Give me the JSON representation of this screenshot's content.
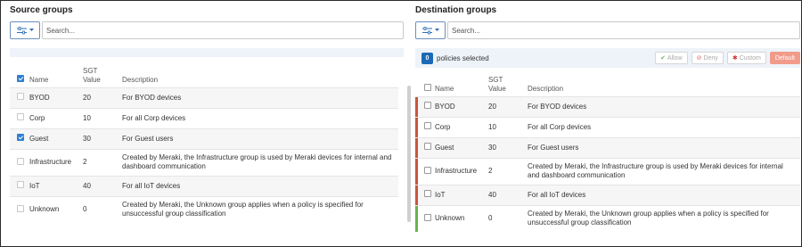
{
  "source": {
    "title": "Source groups",
    "search_placeholder": "Search...",
    "columns": {
      "name": "Name",
      "sgt": "SGT\nValue",
      "description": "Description"
    },
    "rows": [
      {
        "name": "BYOD",
        "sgt": "20",
        "description": "For BYOD devices",
        "checked": false
      },
      {
        "name": "Corp",
        "sgt": "10",
        "description": "For all Corp devices",
        "checked": false
      },
      {
        "name": "Guest",
        "sgt": "30",
        "description": "For Guest users",
        "checked": true
      },
      {
        "name": "Infrastructure",
        "sgt": "2",
        "description": "Created by Meraki, the Infrastructure group is used by Meraki devices for internal and dashboard communication",
        "checked": false
      },
      {
        "name": "IoT",
        "sgt": "40",
        "description": "For all IoT devices",
        "checked": false
      },
      {
        "name": "Unknown",
        "sgt": "0",
        "description": "Created by Meraki, the Unknown group applies when a policy is specified for unsuccessful group classification",
        "checked": false
      }
    ]
  },
  "destination": {
    "title": "Destination groups",
    "search_placeholder": "Search...",
    "selected_count": "0",
    "selected_text": "policies selected",
    "actions": {
      "allow": "Allow",
      "deny": "Deny",
      "custom": "Custom",
      "default": "Default"
    },
    "columns": {
      "name": "Name",
      "sgt": "SGT\nValue",
      "description": "Description"
    },
    "rows": [
      {
        "name": "BYOD",
        "sgt": "20",
        "description": "For BYOD devices",
        "bar": "#c8553d"
      },
      {
        "name": "Corp",
        "sgt": "10",
        "description": "For all Corp devices",
        "bar": "#c8553d"
      },
      {
        "name": "Guest",
        "sgt": "30",
        "description": "For Guest users",
        "bar": "#c8553d"
      },
      {
        "name": "Infrastructure",
        "sgt": "2",
        "description": "Created by Meraki, the Infrastructure group is used by Meraki devices for internal and dashboard communication",
        "bar": "#c8553d"
      },
      {
        "name": "IoT",
        "sgt": "40",
        "description": "For all IoT devices",
        "bar": "#c8553d"
      },
      {
        "name": "Unknown",
        "sgt": "0",
        "description": "Created by Meraki, the Unknown group applies when a policy is specified for unsuccessful group classification",
        "bar": "#6bb34a"
      }
    ]
  },
  "colors": {
    "accent": "#2f7fd2",
    "deny_bar": "#c8553d",
    "allow_bar": "#6bb34a",
    "default_btn": "#f29b8a"
  }
}
